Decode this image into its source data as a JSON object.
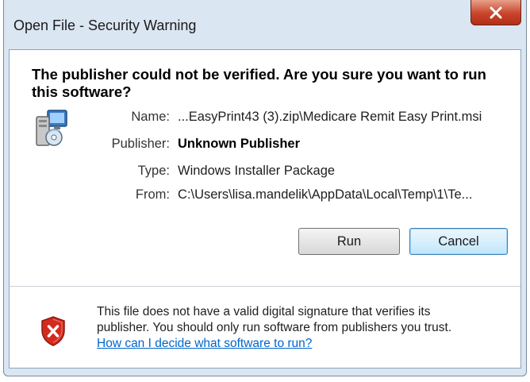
{
  "window": {
    "title": "Open File - Security Warning",
    "close_glyph": "X"
  },
  "warning": {
    "headline": "The publisher could not be verified.  Are you sure you want to run this software?"
  },
  "fields": [
    {
      "label": "Name:",
      "value": "...EasyPrint43 (3).zip\\Medicare Remit Easy Print.msi",
      "bold": false
    },
    {
      "label": "Publisher:",
      "value": "Unknown Publisher",
      "bold": true
    },
    {
      "label": "Type:",
      "value": "Windows Installer Package",
      "bold": false
    },
    {
      "label": "From:",
      "value": "C:\\Users\\lisa.mandelik\\AppData\\Local\\Temp\\1\\Te...",
      "bold": false
    }
  ],
  "buttons": {
    "run": "Run",
    "cancel": "Cancel"
  },
  "footer": {
    "line1": "This file does not have a valid digital signature that verifies its",
    "line2": "publisher.  You should only run software from publishers you trust.",
    "link": "How can I decide what software to run?"
  },
  "icons": {
    "installer": "installer-package-icon",
    "shield": "shield-error-icon",
    "close": "close-icon"
  },
  "colors": {
    "close_button": "#c9442a",
    "link": "#0066cc",
    "frame": "#dbe6f3",
    "shield_red": "#d42a1e"
  }
}
